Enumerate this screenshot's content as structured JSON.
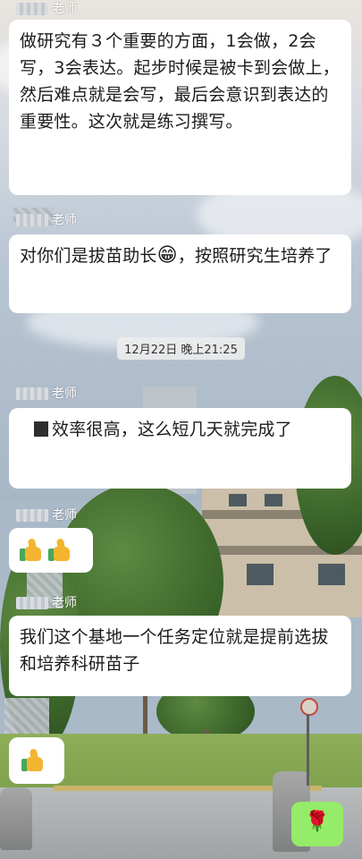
{
  "messages": [
    {
      "sender": "老师",
      "text": "做研究有３个重要的方面，1会做，2会写，3会表达。起步时候是被卡到会做上，然后难点就是会写，最后会意识到表达的重要性。这次就是练习撰写。"
    },
    {
      "sender": "老师",
      "text_before": "对你们是拔苗助长",
      "emoji": "😁",
      "text_after": "，按照研究生培养了"
    },
    {
      "sender": "老师",
      "text": "效率很高，这么短几天就完成了"
    },
    {
      "sender": "老师",
      "emoji_desc": "thumbs-up x2"
    },
    {
      "sender": "老师",
      "text": "我们这个基地一个任务定位就是提前选拔和培养科研苗子"
    },
    {
      "sender": "",
      "emoji_desc": "thumbs-up x1"
    }
  ],
  "timestamp": "12月22日 晚上21:25",
  "outgoing": {
    "emoji": "🌹"
  },
  "colors": {
    "bubble_in": "#ffffff",
    "bubble_out": "#95ec69",
    "name_text": "#ffffff"
  },
  "icons": {
    "thumbs_up": "thumbs-up-icon",
    "grin": "grin-emoji",
    "rose": "rose-emoji"
  }
}
